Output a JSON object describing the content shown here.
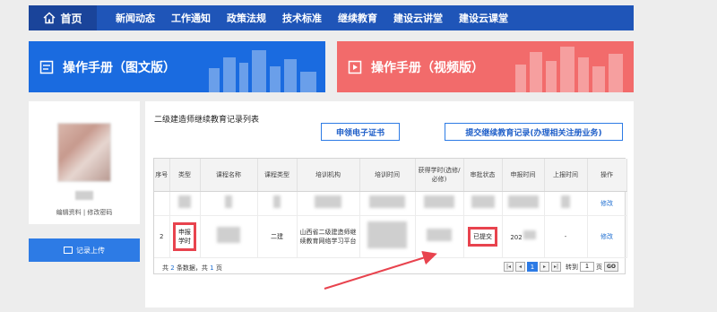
{
  "nav": {
    "home": "首页",
    "items": [
      "新闻动态",
      "工作通知",
      "政策法规",
      "技术标准",
      "继续教育",
      "建设云讲堂",
      "建设云课堂"
    ]
  },
  "banners": {
    "manual_text": "操作手册（图文版）",
    "manual_video": "操作手册（视频版）"
  },
  "profile": {
    "links": "编辑资料 | 修改密码"
  },
  "sidebar": {
    "upload_label": "记录上传"
  },
  "main": {
    "title": "二级建造师继续教育记录列表",
    "cert_button": "申领电子证书",
    "submit_button": "提交继续教育记录(办理相关注册业务)"
  },
  "table": {
    "headers": [
      "序号",
      "类型",
      "课程名称",
      "课程类型",
      "培训机构",
      "培训时间",
      "获得学时(选修/必修)",
      "审批状态",
      "申报时间",
      "上报时间",
      "操作"
    ],
    "rows": [
      {
        "op": "修改"
      },
      {
        "index": "2",
        "type": "申报学时",
        "course_type": "二建",
        "org": "山西省二级建造师继续教育网络学习平台",
        "status": "已提交",
        "apply_time": "202",
        "report_time": "-",
        "op": "修改"
      }
    ]
  },
  "pager": {
    "total_prefix": "共",
    "total_count": "2",
    "total_mid": "条数据，共",
    "total_pages": "1",
    "total_suffix": "页",
    "current_page": "1",
    "goto_label": "转到",
    "goto_value": "1",
    "page_suffix": "页",
    "go_label": "GO"
  },
  "colors": {
    "nav_blue": "#1f55b8",
    "banner_blue": "#1a6be0",
    "banner_red": "#f26b6b",
    "highlight_red": "#e8434e"
  }
}
